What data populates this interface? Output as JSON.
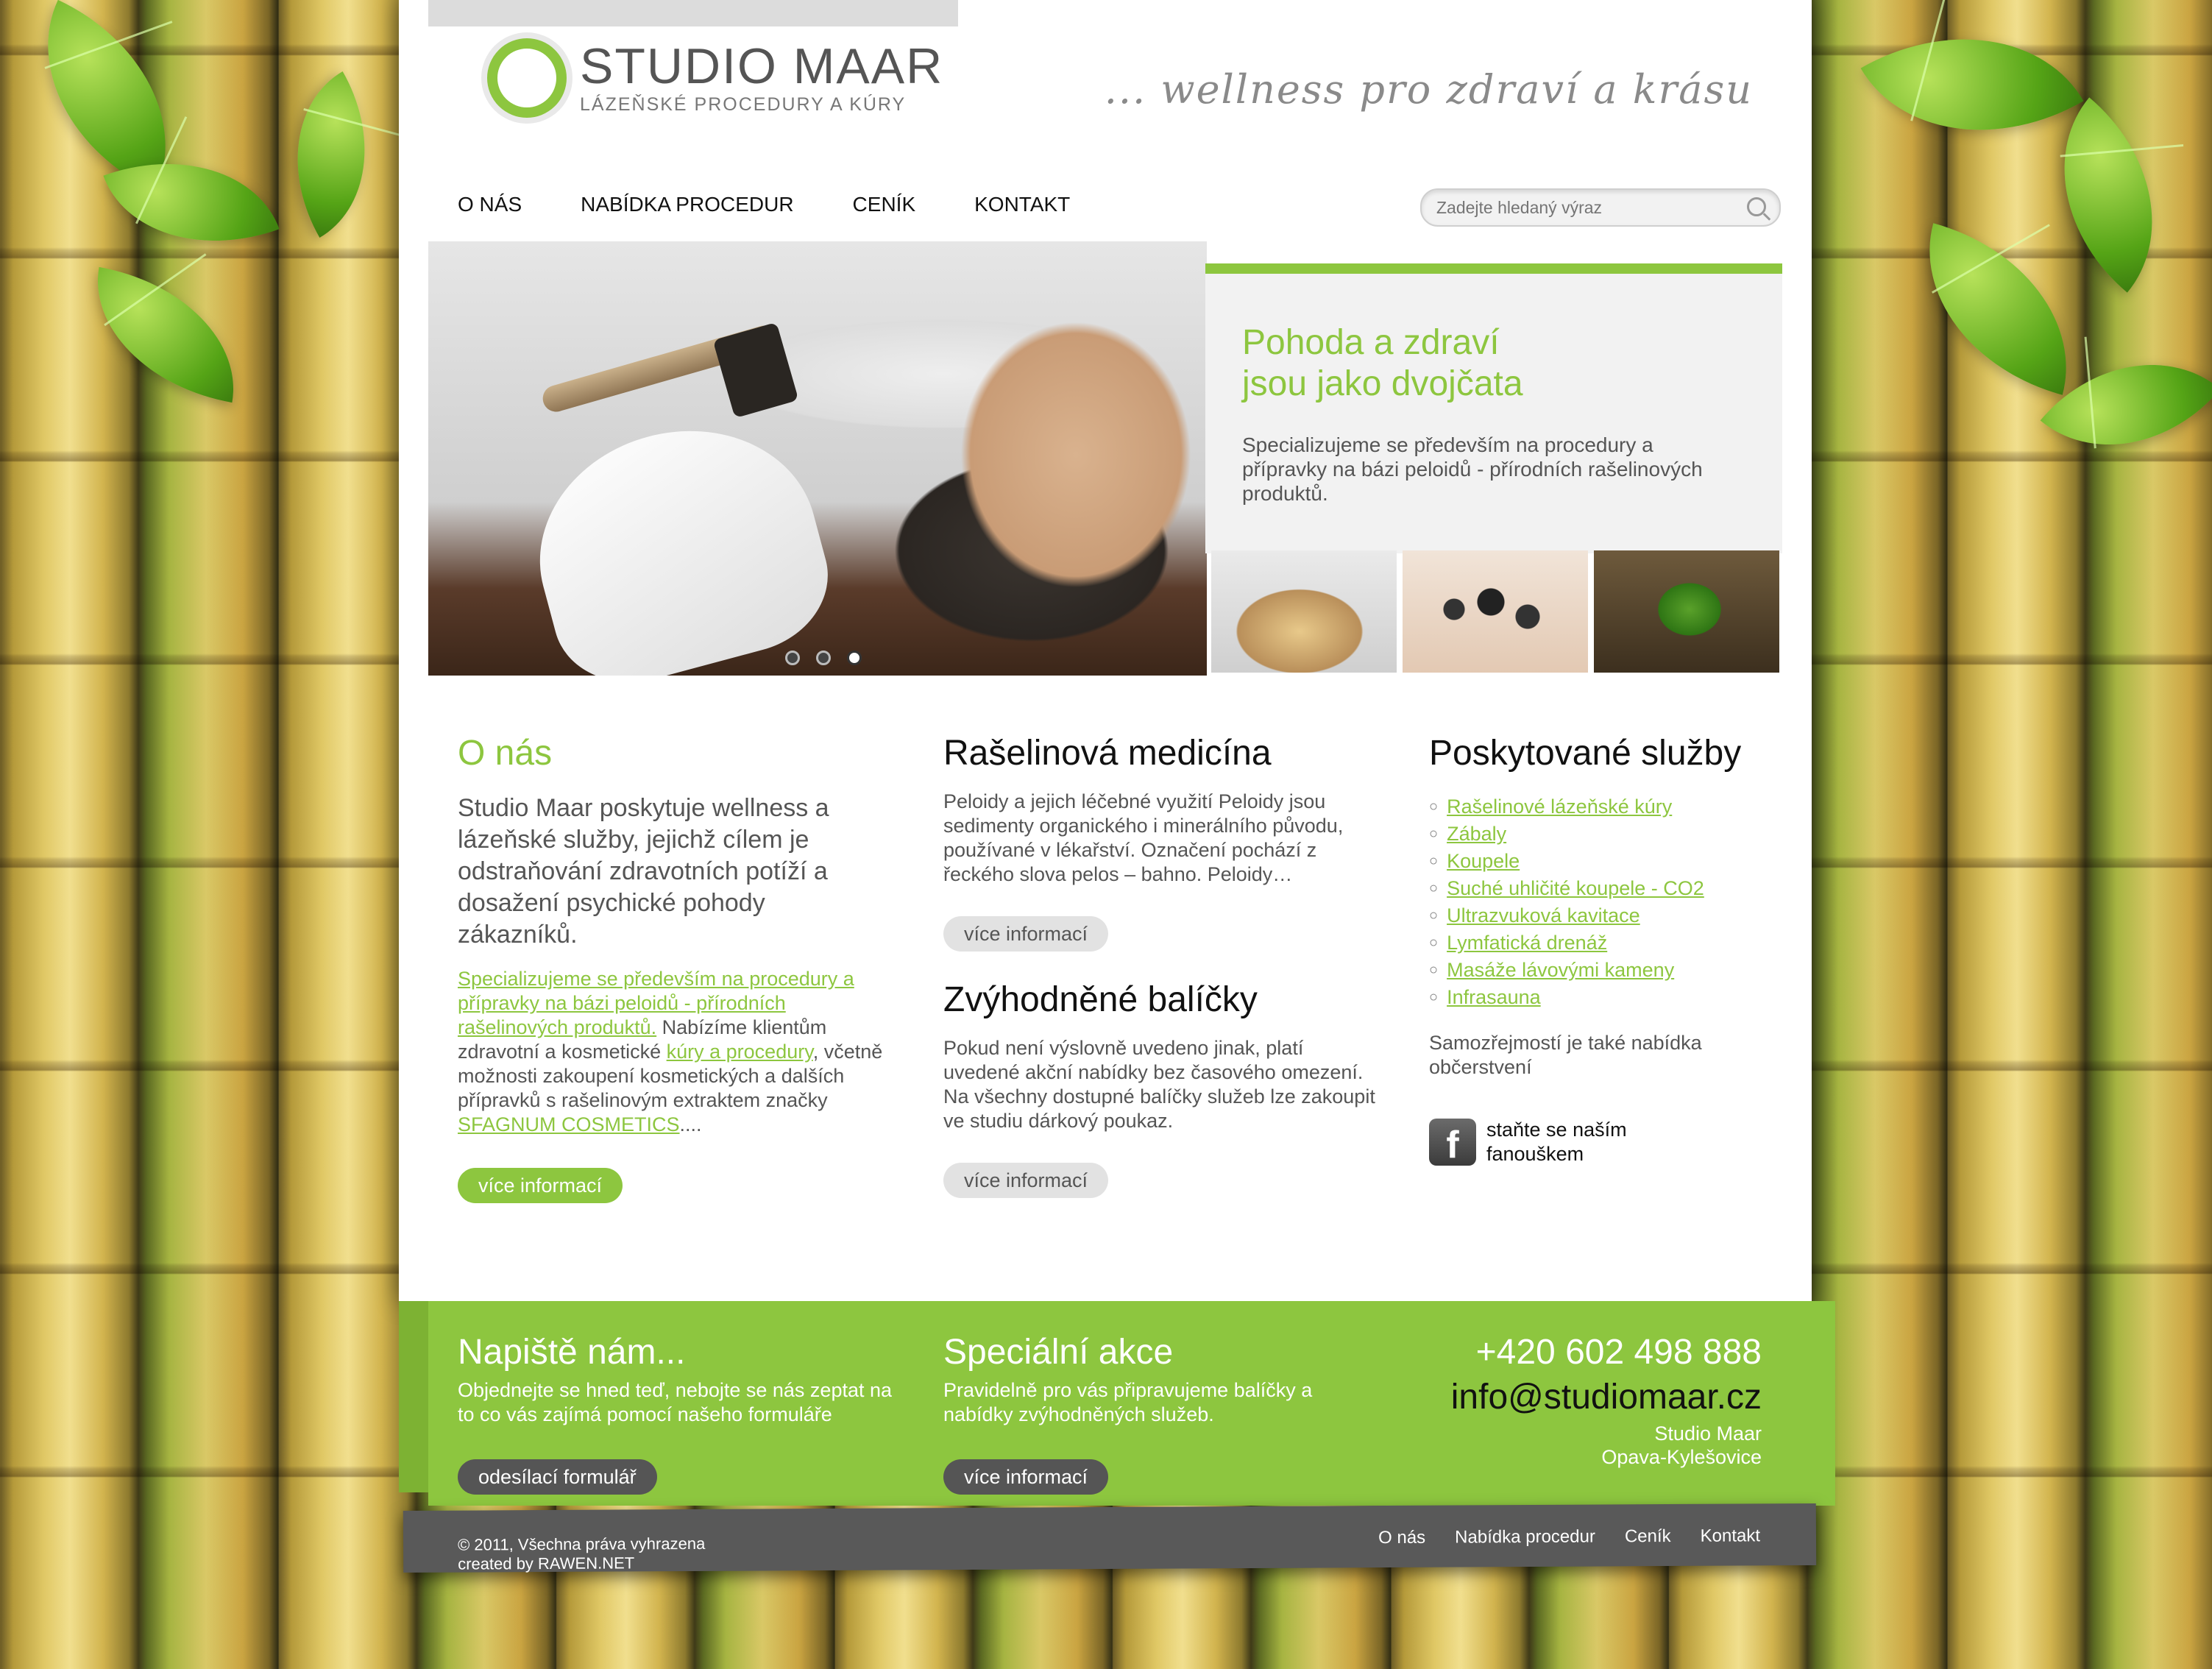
{
  "header": {
    "logo_title": "STUDIO MAAR",
    "logo_subtitle": "LÁZEŇSKÉ PROCEDURY A KÚRY",
    "tagline": "... wellness pro zdraví a krásu"
  },
  "nav": {
    "items": [
      "O NÁS",
      "NABÍDKA PROCEDUR",
      "CENÍK",
      "KONTAKT"
    ]
  },
  "search": {
    "placeholder": "Zadejte hledaný výraz",
    "icon": "search-icon"
  },
  "hero": {
    "slides_count": 3,
    "active_slide": 3
  },
  "promo": {
    "title_line1": "Pohoda a zdraví",
    "title_line2": "jsou jako dvojčata",
    "text": "Specializujeme se především na procedury a přípravky na bázi peloidů - přírodních rašelinových produktů."
  },
  "about": {
    "title": "O nás",
    "lead": "Studio Maar poskytuje wellness a lázeňské služby, jejichž cílem je odstraňování zdravotních potíží a dosažení psychické pohody zákazníků.",
    "link1": "Specializujeme se především na procedury a přípravky na bázi peloidů - přírodních rašelinových produktů.",
    "text1": " Nabízíme klientům zdravotní a kosmetické ",
    "link2": "kúry a procedury",
    "text2": ", včetně možnosti zakoupení kosmetických a dalších přípravků s rašelinovým extraktem značky ",
    "brand": "SFAGNUM COSMETICS",
    "text3": "....",
    "button": "více informací"
  },
  "peat": {
    "title": "Rašelinová medicína",
    "text": "Peloidy a jejich léčebné využití Peloidy jsou sedimenty organického i minerálního původu, používané v lékařství. Označení pochází z řeckého slova pelos – bahno. Peloidy…",
    "button": "více informací"
  },
  "packages": {
    "title": "Zvýhodněné balíčky",
    "text": "Pokud není výslovně uvedeno jinak, platí uvedené akční nabídky bez časového omezení. Na všechny dostupné balíčky služeb lze zakoupit ve studiu dárkový poukaz.",
    "button": "více informací"
  },
  "services": {
    "title": "Poskytované služby",
    "items": [
      "Rašelinové lázeňské kúry",
      "Zábaly",
      "Koupele",
      "Suché uhličité koupele - CO2",
      "Ultrazvuková kavitace",
      "Lymfatická drenáž",
      "Masáže lávovými kameny",
      "Infrasauna"
    ],
    "note": "Samozřejmostí je také nabídka občerstvení",
    "fb_text": "staňte se naším fanouškem",
    "fb_icon": "facebook-icon"
  },
  "contact_band": {
    "write_title": "Napiště nám...",
    "write_text": "Objednejte se hned teď, nebojte se nás zeptat na to co vás zajímá pomocí našeho formuláře",
    "write_button": "odesílací formulář",
    "special_title": "Speciální akce",
    "special_text": "Pravidelně pro vás připravujeme balíčky a nabídky zvýhodněných služeb.",
    "special_button": "více informací",
    "phone": "+420 602 498 888",
    "email": "info@studiomaar.cz",
    "address_line1": "Studio Maar",
    "address_line2": "Opava-Kylešovice"
  },
  "footer": {
    "copyright": "© 2011, Všechna práva vyhrazena",
    "created_by": "created by RAWEN.NET",
    "links": [
      "O nás",
      "Nabídka procedur",
      "Ceník",
      "Kontakt"
    ]
  },
  "colors": {
    "accent": "#8dc63f",
    "dark_button": "#555555",
    "footer": "#595959"
  }
}
